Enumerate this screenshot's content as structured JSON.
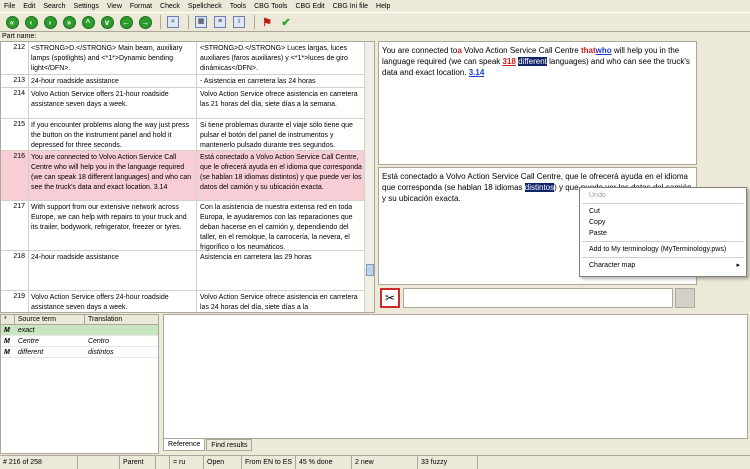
{
  "menu": [
    "File",
    "Edit",
    "Search",
    "Settings",
    "View",
    "Format",
    "Check",
    "Spellcheck",
    "Tools",
    "CBG Tools",
    "CBG Edit",
    "CBG Ini file",
    "Help"
  ],
  "part_name_label": "Part name:",
  "rows": [
    {
      "num": "212",
      "src": "<STRONG>D.</STRONG> Main beam, auxiliary lamps (spotlights) and <*1*>Dynamic bending light</DFN>.",
      "tgt": "<STRONG>D.</STRONG> Luces largas, luces auxiliares (faros auxiliares) y <*1*>luces de giro dinámicas</DFN>."
    },
    {
      "num": "213",
      "src": "24-hour roadside assistance",
      "tgt": "- Asistencia en carretera las 24 horas"
    },
    {
      "num": "214",
      "src": "Volvo Action Service offers 21-hour roadside assistance seven days a week.",
      "tgt": "Volvo Action Service ofrece asistencia en carretera las 21 horas del día, siete días a la semana."
    },
    {
      "num": "215",
      "src": "If you encounter problems along the way just press the button on the instrument panel and hold it depressed for three seconds.",
      "tgt": "Si tiene problemas durante el viaje sólo tiene que pulsar el botón del panel de instrumentos y mantenerlo pulsado durante tres segundos."
    },
    {
      "num": "216",
      "src": "You are connected to Volvo Action Service Call Centre who will help you in the language required (we can speak 18 different languages) and who can see the truck's data and exact location. 3.14",
      "tgt": "Está conectado a Volvo Action Service Call Centre, que le ofrecerá ayuda en el idioma que corresponda (se hablan 18 idiomas distintos) y que puede ver los datos del camión y su ubicación exacta."
    },
    {
      "num": "217",
      "src": "With support from our extensive network across Europe, we can help with repairs to your truck and its trailer, bodywork, refrigerator, freezer or tyres.",
      "tgt": "Con la asistencia de nuestra extensa red en toda Europa, le ayudaremos con las reparaciones que deban hacerse en el camión y, dependiendo del taller, en el remolque, la carrocería, la nevera, el frigorífico o los neumáticos."
    },
    {
      "num": "218",
      "src": "24-hour roadside assistance",
      "tgt": "Asistencia en carretera las 29 horas"
    },
    {
      "num": "219",
      "src": "Volvo Action Service offers 24-hour roadside assistance seven days a week.",
      "tgt": "Volvo Action Service ofrece asistencia en carretera las 24 horas del día, siete días a la"
    }
  ],
  "source_panel": {
    "part1": "You are connected to",
    "mark_a": "a",
    "part2": " Volvo Action Service Call Centre ",
    "mark_that": "that",
    "mark_who": "who",
    "part3": " will help you in the language required (we can speak ",
    "num_318": "318",
    "hl_different": "different",
    "part4": " languages) and who can see the truck's data and exact location. ",
    "num_314": "3.14"
  },
  "target_panel": {
    "part1": "Está conectado a Volvo Action Service Call Centre, que le ofrecerá ayuda en el idioma que corresponda (se hablan 18 idiomas ",
    "hl_word": "distintos",
    "part2": ") y que puede ver los datos del camión y su ubicación exacta."
  },
  "context_menu": {
    "undo": "Undo",
    "cut": "Cut",
    "copy": "Copy",
    "paste": "Paste",
    "add_term": "Add to My terminology (MyTerminology.pws)",
    "char_map": "Character map",
    "arrow": "▸"
  },
  "terms": {
    "headers": [
      "*",
      "Source term",
      "Translation"
    ],
    "rows": [
      {
        "mark": "M",
        "src": "exact",
        "tgt": ""
      },
      {
        "mark": "M",
        "src": "Centre",
        "tgt": "Centro"
      },
      {
        "mark": "M",
        "src": "different",
        "tgt": "distintos"
      }
    ]
  },
  "tabs": [
    "Reference",
    "Find results"
  ],
  "status": [
    "# 216 of 258",
    "",
    "Parent",
    "",
    "= ru",
    "Open",
    "From EN to ES",
    "45 % done",
    "2 new",
    "33 fuzzy"
  ]
}
